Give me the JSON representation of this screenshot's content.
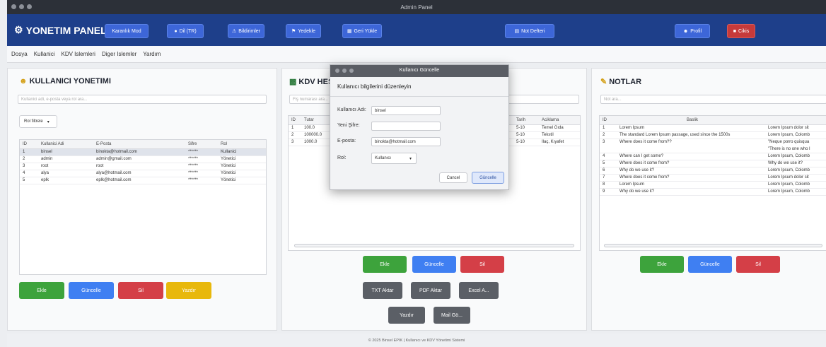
{
  "window": {
    "title": "Admin Panel"
  },
  "topbar": {
    "brand": "YONETIM PANELI",
    "buttons": {
      "dark_mode": "Karanlık Mod",
      "lang": "Dil (TR)",
      "notifications": "Bildirimler",
      "backup": "Yedekle",
      "load_data": "Geri Yükle",
      "notebook": "Not Defteri",
      "profile": "Profil",
      "logout": "Cikis"
    }
  },
  "menu": [
    "Dosya",
    "Kullanici",
    "KDV Islemleri",
    "Diger Islemler",
    "Yardım"
  ],
  "users": {
    "title": "KULLANICI YONETIMI",
    "search_placeholder": "Kullanici adi, e-posta veya rol ara...",
    "role_filter": "Rol filtrele",
    "columns": [
      "ID",
      "Kullanici Adi",
      "E-Posta",
      "Sifre",
      "Rol"
    ],
    "rows": [
      [
        "1",
        "binsel",
        "binokta@hotmail.com",
        "******",
        "Kullanici"
      ],
      [
        "2",
        "admin",
        "admin@gmail.com",
        "******",
        "Yönetici"
      ],
      [
        "3",
        "root",
        "root",
        "******",
        "Yönetici"
      ],
      [
        "4",
        "alya",
        "alya@hotmail.com",
        "******",
        "Yönetici"
      ],
      [
        "5",
        "eplk",
        "eplk@hotmail.com",
        "******",
        "Yönetici"
      ]
    ],
    "buttons": {
      "add": "Ekle",
      "update": "Güncelle",
      "delete": "Sil",
      "print": "Yazdır"
    }
  },
  "kdv": {
    "title": "KDV HESAPLAMA",
    "search_placeholder": "Fiş numarası ara...",
    "columns": [
      "ID",
      "Tutar",
      "Tarih",
      "Aciklama"
    ],
    "rows": [
      [
        "1",
        "100.0",
        "5-10",
        "Temel Gıda"
      ],
      [
        "2",
        "100000.0",
        "5-10",
        "Tekstil"
      ],
      [
        "3",
        "1000.0",
        "5-10",
        "İlaç, Kıyafet"
      ]
    ],
    "buttons": {
      "add": "Ekle",
      "update": "Güncelle",
      "delete": "Sil",
      "txt": "TXT Aktar",
      "pdf": "PDF Aktar",
      "excel": "Excel A...",
      "print": "Yazdır",
      "mail": "Mail Gö..."
    }
  },
  "notes": {
    "title": "NOTLAR",
    "search_placeholder": "Not ara...",
    "columns": [
      "ID",
      "Baslik",
      ""
    ],
    "rows": [
      [
        "1",
        "Lorem Ipsum",
        "Lorem Ipsum dolor sit"
      ],
      [
        "2",
        "The standard Lorem Ipsum passage, used since the 1500s",
        "Lorem Ipsum, Colomb"
      ],
      [
        "3",
        "Where does it come from??",
        "\"Neque porro quisqua"
      ],
      [
        "",
        "",
        "\"There is no one who l"
      ],
      [
        "4",
        "Where can I get some?",
        "Lorem Ipsum, Colomb"
      ],
      [
        "5",
        "Where does it come from?",
        "Why do we use it?"
      ],
      [
        "6",
        "Why do we use it?",
        "Lorem Ipsum, Colomb"
      ],
      [
        "7",
        "Where does it come from?",
        "Lorem Ipsum dolor sit"
      ],
      [
        "8",
        "Lorem Ipsum",
        "Lorem Ipsum, Colomb"
      ],
      [
        "9",
        "Why do we use it?",
        "Lorem Ipsum, Colomb"
      ]
    ],
    "buttons": {
      "add": "Ekle",
      "update": "Güncelle",
      "delete": "Sil"
    }
  },
  "dialog": {
    "title": "Kullanıcı Güncelle",
    "heading": "Kullanıcı bilgilerini düzenleyin",
    "labels": {
      "username": "Kullanıcı Adı:",
      "password": "Yeni Şifre:",
      "email": "E-posta:",
      "role": "Rol:"
    },
    "values": {
      "username": "binsel",
      "password": "",
      "email": "binokta@hotmail.com",
      "role": "Kullanıcı"
    },
    "buttons": {
      "cancel": "Cancel",
      "update": "Güncelle"
    }
  },
  "footer": "© 2025 Binsel EPIK | Kullanıcı ve KDV Yönetimi Sistemi"
}
